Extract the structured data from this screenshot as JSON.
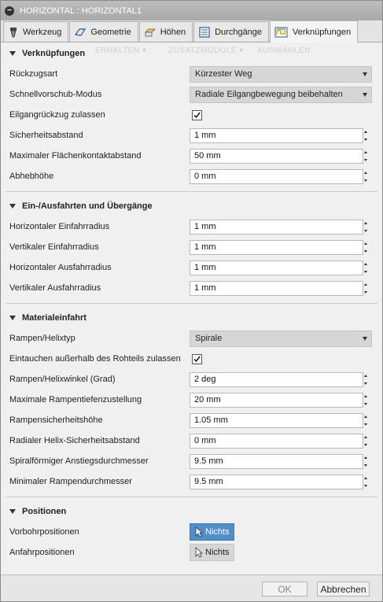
{
  "window": {
    "title": "HORIZONTAL : HORIZONTAL1"
  },
  "tabs": [
    {
      "label": "Werkzeug",
      "icon": "tool-icon"
    },
    {
      "label": "Geometrie",
      "icon": "geometry-icon"
    },
    {
      "label": "Höhen",
      "icon": "heights-icon"
    },
    {
      "label": "Durchgänge",
      "icon": "passes-icon"
    },
    {
      "label": "Verknüpfungen",
      "icon": "linking-icon",
      "active": true
    }
  ],
  "ghost_toolbar": [
    "ERHALTEN ▾",
    "ZUSATZMODULE ▾",
    "AUSWÄHLEN"
  ],
  "sections": {
    "verknuepfungen": {
      "title": "Verknüpfungen",
      "rueckzugsart": {
        "label": "Rückzugsart",
        "value": "Kürzester Weg"
      },
      "schnellvorschub": {
        "label": "Schnellvorschub-Modus",
        "value": "Radiale Eilgangbewegung beibehalten"
      },
      "eilgang": {
        "label": "Eilgangrückzug zulassen",
        "checked": true
      },
      "sicherheitsabstand": {
        "label": "Sicherheitsabstand",
        "value": "1 mm"
      },
      "flaechenkontakt": {
        "label": "Maximaler Flächenkontaktabstand",
        "value": "50 mm"
      },
      "abhebehoehe": {
        "label": "Abhebhöhe",
        "value": "0 mm"
      }
    },
    "einausfahrten": {
      "title": "Ein-/Ausfahrten und Übergänge",
      "h_einfahr": {
        "label": "Horizontaler Einfahrradius",
        "value": "1 mm"
      },
      "v_einfahr": {
        "label": "Vertikaler Einfahrradius",
        "value": "1 mm"
      },
      "h_ausfahr": {
        "label": "Horizontaler Ausfahrradius",
        "value": "1 mm"
      },
      "v_ausfahr": {
        "label": "Vertikaler Ausfahrradius",
        "value": "1 mm"
      }
    },
    "materialeinfahrt": {
      "title": "Materialeinfahrt",
      "rampentyp": {
        "label": "Rampen/Helixtyp",
        "value": "Spirale"
      },
      "eintauchen": {
        "label": "Eintauchen außerhalb des Rohteils zulassen",
        "checked": true
      },
      "winkel": {
        "label": "Rampen/Helixwinkel (Grad)",
        "value": "2 deg"
      },
      "tiefenzustellung": {
        "label": "Maximale Rampentiefenzustellung",
        "value": "20 mm"
      },
      "sicherheitshoehe": {
        "label": "Rampensicherheitshöhe",
        "value": "1.05 mm"
      },
      "helix_abstand": {
        "label": "Radialer Helix-Sicherheitsabstand",
        "value": "0 mm"
      },
      "anstieg": {
        "label": "Spiralförmiger Anstiegsdurchmesser",
        "value": "9.5 mm"
      },
      "min_durchmesser": {
        "label": "Minimaler Rampendurchmesser",
        "value": "9.5 mm"
      }
    },
    "positionen": {
      "title": "Positionen",
      "vorbohr": {
        "label": "Vorbohrpositionen",
        "value": "Nichts",
        "active": true
      },
      "anfahr": {
        "label": "Anfahrpositionen",
        "value": "Nichts",
        "active": false
      }
    }
  },
  "footer": {
    "ok_label": "OK",
    "cancel_label": "Abbrechen"
  },
  "colors": {
    "accent": "#4f8fcc",
    "titlebar": "#b0b0b0"
  }
}
